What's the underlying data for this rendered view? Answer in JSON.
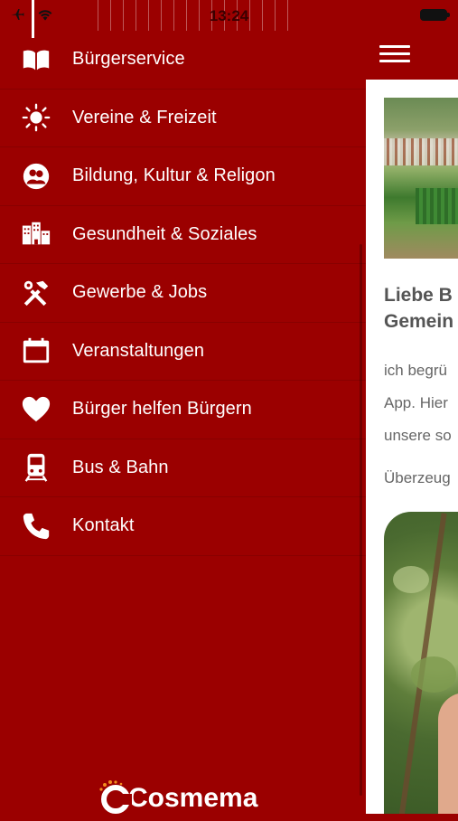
{
  "status_bar": {
    "time": "13:24"
  },
  "menu": {
    "items": [
      {
        "label": "Bürgerservice",
        "icon": "book-icon"
      },
      {
        "label": "Vereine & Freizeit",
        "icon": "sun-icon"
      },
      {
        "label": "Bildung, Kultur & Religon",
        "icon": "people-icon"
      },
      {
        "label": "Gesundheit & Soziales",
        "icon": "buildings-icon"
      },
      {
        "label": "Gewerbe & Jobs",
        "icon": "tools-icon"
      },
      {
        "label": "Veranstaltungen",
        "icon": "calendar-icon"
      },
      {
        "label": "Bürger helfen Bürgern",
        "icon": "heart-icon"
      },
      {
        "label": "Bus & Bahn",
        "icon": "train-icon"
      },
      {
        "label": "Kontakt",
        "icon": "phone-icon"
      }
    ]
  },
  "brand": {
    "logo_text": "Cosmema"
  },
  "content": {
    "heading": "Liebe B Gemein",
    "paragraph1": "ich begrü App. Hier unsere so",
    "paragraph2": "Überzeug"
  },
  "colors": {
    "primary": "#9b0000",
    "content_bg": "#ffffff"
  }
}
